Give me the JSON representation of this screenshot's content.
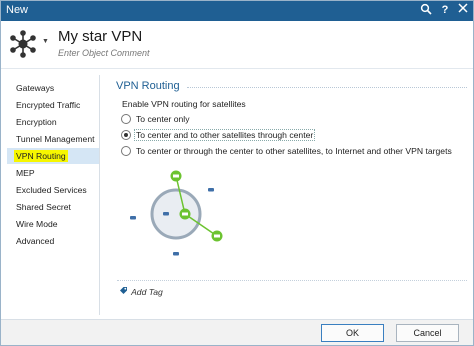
{
  "window": {
    "title": "New"
  },
  "header": {
    "object_name": "My star VPN",
    "comment_placeholder": "Enter Object Comment"
  },
  "sidebar": {
    "items": [
      {
        "label": "Gateways",
        "active": false
      },
      {
        "label": "Encrypted Traffic",
        "active": false
      },
      {
        "label": "Encryption",
        "active": false
      },
      {
        "label": "Tunnel Management",
        "active": false
      },
      {
        "label": "VPN Routing",
        "active": true
      },
      {
        "label": "MEP",
        "active": false
      },
      {
        "label": "Excluded Services",
        "active": false
      },
      {
        "label": "Shared Secret",
        "active": false
      },
      {
        "label": "Wire Mode",
        "active": false
      },
      {
        "label": "Advanced",
        "active": false
      }
    ]
  },
  "main": {
    "section_title": "VPN Routing",
    "enable_label": "Enable VPN routing for satellites",
    "options": [
      {
        "label": "To center only",
        "selected": false
      },
      {
        "label": "To center and to other satellites through center",
        "selected": true
      },
      {
        "label": "To center or through the center to other satellites, to Internet and other VPN targets",
        "selected": false
      }
    ],
    "add_tag_label": "Add Tag"
  },
  "footer": {
    "ok_label": "OK",
    "cancel_label": "Cancel"
  },
  "colors": {
    "titlebar": "#1f5f93",
    "accent": "#1f5f93",
    "highlight": "#f6f600",
    "active_node": "#6cc330"
  },
  "icons": [
    "search-icon",
    "help-icon",
    "close-icon",
    "star-vpn-icon",
    "tag-icon"
  ]
}
